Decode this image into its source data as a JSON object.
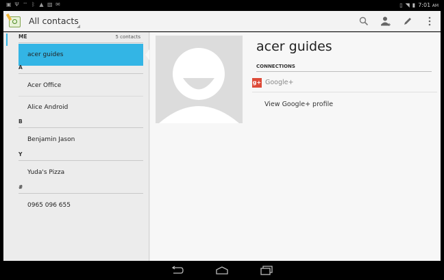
{
  "status_bar": {
    "notification_icons": [
      "photo-icon",
      "usb-icon",
      "wifi-icon",
      "bluetooth-icon",
      "warning-icon",
      "image-icon",
      "mail-icon"
    ],
    "time": "7:01",
    "time_suffix": "AM"
  },
  "action_bar": {
    "title": "All contacts",
    "actions": [
      "search-icon",
      "add-contact-icon",
      "edit-icon",
      "overflow-menu-icon"
    ]
  },
  "contact_list": {
    "me_header": "ME",
    "contacts_count": "5 contacts",
    "items": [
      {
        "type": "contact",
        "label": "acer guides",
        "selected": true
      },
      {
        "type": "header",
        "label": "A"
      },
      {
        "type": "contact",
        "label": "Acer Office"
      },
      {
        "type": "contact",
        "label": "Alice Android"
      },
      {
        "type": "header",
        "label": "B"
      },
      {
        "type": "contact",
        "label": "Benjamin Jason"
      },
      {
        "type": "header",
        "label": "Y"
      },
      {
        "type": "contact",
        "label": "Yuda's Pizza"
      },
      {
        "type": "header",
        "label": "#"
      },
      {
        "type": "contact",
        "label": "0965 096 655"
      }
    ]
  },
  "detail": {
    "name": "acer guides",
    "connections_header": "CONNECTIONS",
    "gplus_logo_text": "g+",
    "gplus_label": "Google+",
    "view_profile": "View Google+ profile"
  },
  "nav_bar": {
    "buttons": [
      "back-icon",
      "home-icon",
      "recents-icon"
    ]
  },
  "colors": {
    "accent": "#33b5e5",
    "gplus": "#dd4b39"
  }
}
